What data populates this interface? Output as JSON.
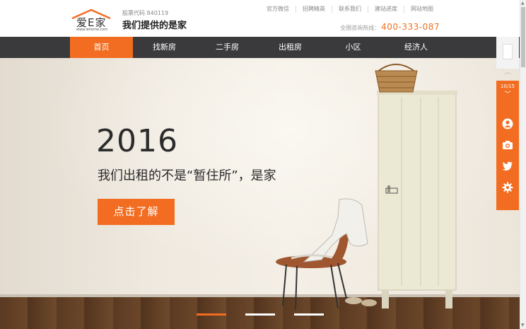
{
  "header": {
    "logo_text": "爱E家",
    "logo_url": "www.iehome.com",
    "stock_code": "股票代码 840119",
    "slogan": "我们提供的是家",
    "top_links": [
      "官方微信",
      "招聘精英",
      "联系我们",
      "建站进度",
      "网站地图"
    ],
    "hotline_label": "全国咨询热线：",
    "hotline_number": "400-333-087"
  },
  "nav": {
    "items": [
      "首页",
      "找新房",
      "二手房",
      "出租房",
      "小区",
      "经济人"
    ],
    "active_index": 0
  },
  "hero": {
    "year": "2016",
    "subtitle": "我们出租的不是“暂住所”，是家",
    "button_label": "点击了解",
    "slide_count": 3,
    "active_slide": 0
  },
  "side": {
    "pager": "10/15",
    "icons": [
      "user-icon",
      "camera-icon",
      "twitter-icon",
      "gear-icon"
    ]
  },
  "colors": {
    "accent": "#f26d21",
    "nav_bg": "#3a3a3c",
    "hotline": "#f07020"
  }
}
